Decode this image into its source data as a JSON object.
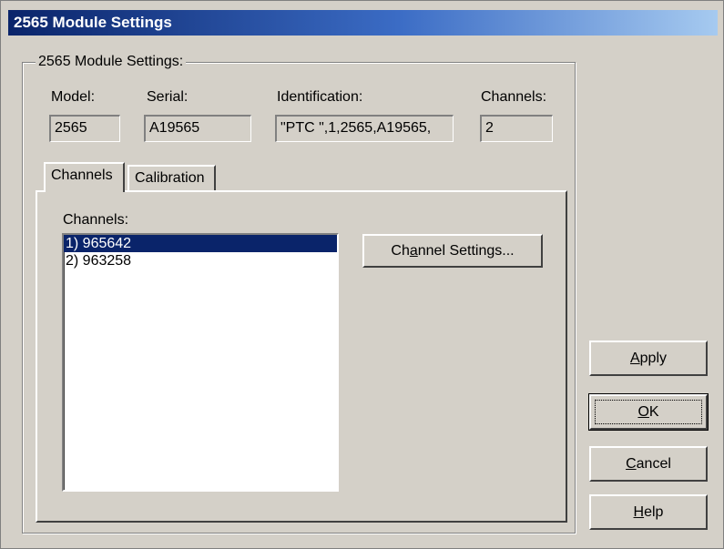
{
  "window": {
    "title": "2565 Module Settings"
  },
  "group": {
    "legend": "2565 Module Settings:"
  },
  "fields": {
    "model": {
      "label": "Model:",
      "value": "2565"
    },
    "serial": {
      "label": "Serial:",
      "value": "A19565"
    },
    "identification": {
      "label": "Identification:",
      "value": "\"PTC \",1,2565,A19565,"
    },
    "channels": {
      "label": "Channels:",
      "value": "2"
    }
  },
  "tabs": [
    {
      "label": "Channels",
      "active": true
    },
    {
      "label": "Calibration",
      "active": false
    }
  ],
  "channels_panel": {
    "list_label": "Channels:",
    "items": [
      "1) 965642",
      "2) 963258"
    ],
    "selected_index": 0,
    "channel_settings_button": {
      "before": "Ch",
      "mnemonic": "a",
      "after": "nnel Settings..."
    }
  },
  "buttons": {
    "apply": {
      "mnemonic": "A",
      "rest": "pply"
    },
    "ok": {
      "mnemonic": "O",
      "rest": "K"
    },
    "cancel": {
      "mnemonic": "C",
      "rest": "ancel"
    },
    "help": {
      "mnemonic": "H",
      "rest": "elp"
    }
  }
}
